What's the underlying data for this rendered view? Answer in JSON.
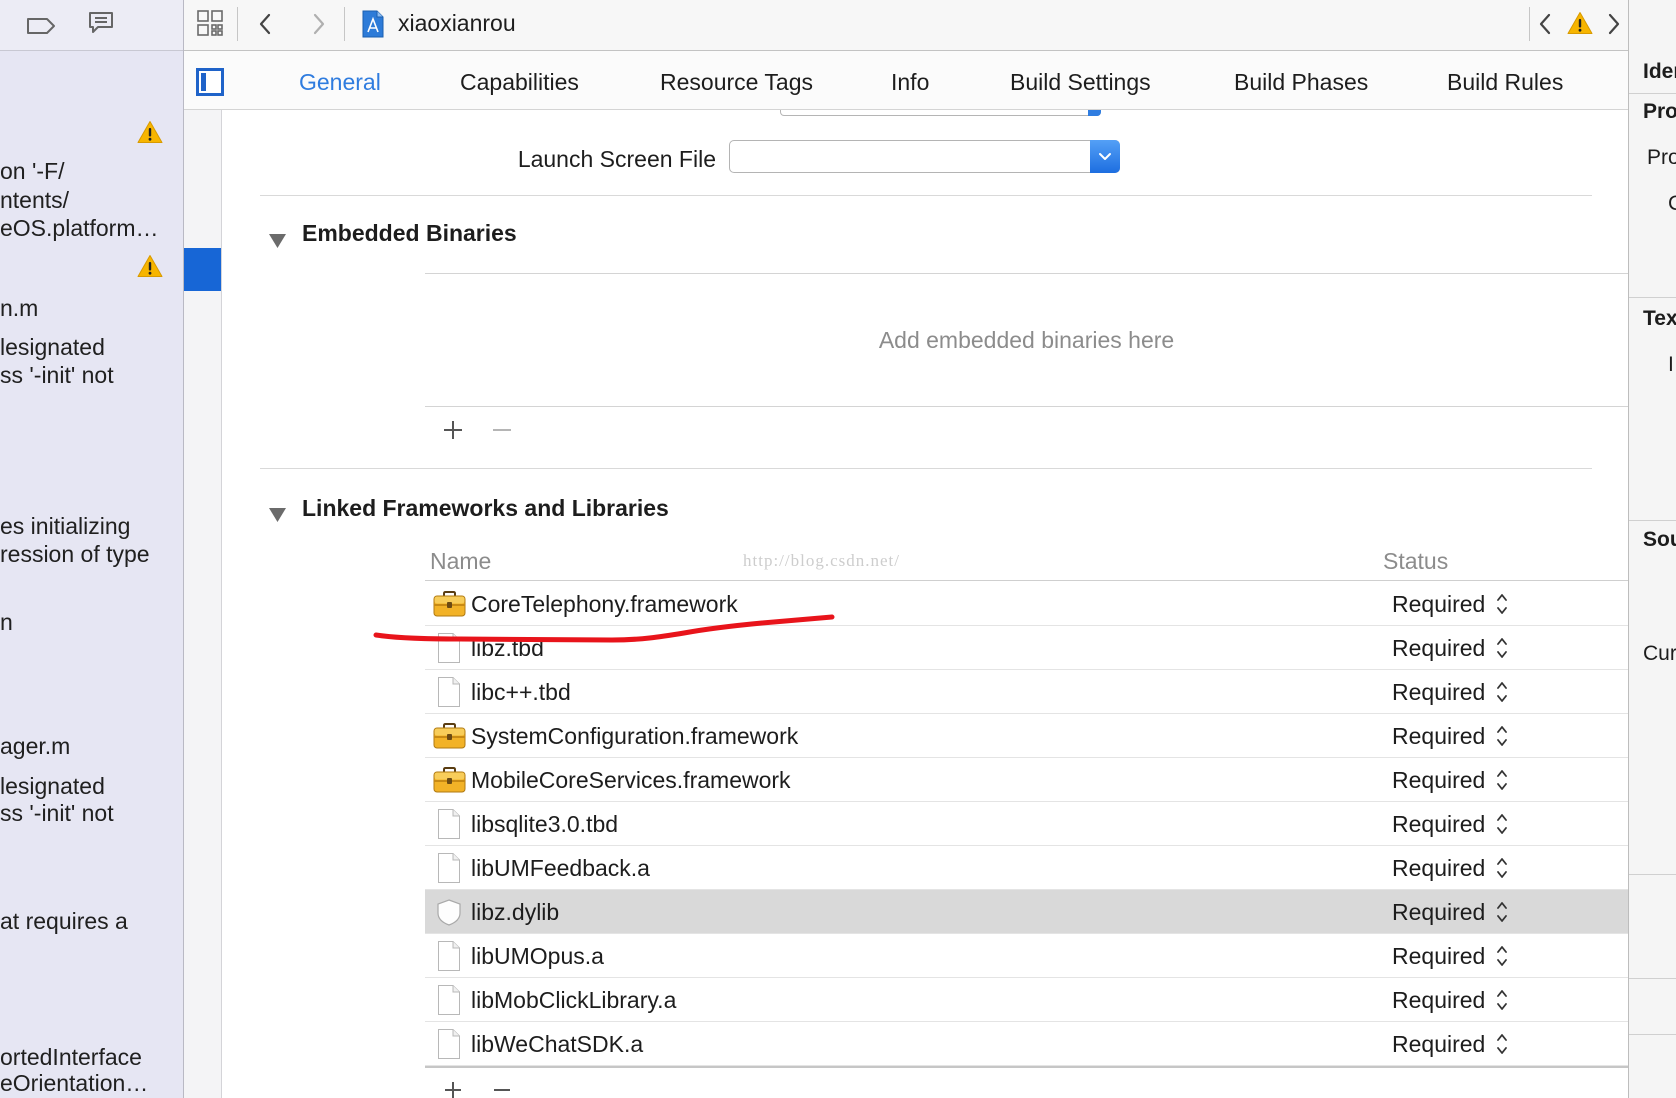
{
  "navigator": {
    "lines": [
      "on '-F/",
      "ntents/",
      "eOS.platform…",
      "n.m",
      "lesignated",
      "ss '-init' not",
      "es initializing",
      "ression of type",
      "n",
      "ager.m",
      "lesignated",
      "ss '-init' not",
      "at requires a",
      "ortedInterface",
      "eOrientation…"
    ]
  },
  "jump_bar": {
    "project_name": "xiaoxianrou"
  },
  "tabs": [
    {
      "label": "General",
      "active": true
    },
    {
      "label": "Capabilities",
      "active": false
    },
    {
      "label": "Resource Tags",
      "active": false
    },
    {
      "label": "Info",
      "active": false
    },
    {
      "label": "Build Settings",
      "active": false
    },
    {
      "label": "Build Phases",
      "active": false
    },
    {
      "label": "Build Rules",
      "active": false
    }
  ],
  "general": {
    "launch_screen": {
      "label": "Launch Screen File"
    },
    "embedded_binaries": {
      "title": "Embedded Binaries",
      "placeholder": "Add embedded binaries here"
    },
    "linked_frameworks": {
      "title": "Linked Frameworks and Libraries",
      "columns": {
        "name": "Name",
        "status": "Status"
      },
      "watermark": "http://blog.csdn.net/",
      "rows": [
        {
          "name": "CoreTelephony.framework",
          "status": "Required",
          "icon": "framework-icon",
          "selected": false
        },
        {
          "name": "libz.tbd",
          "status": "Required",
          "icon": "file-icon",
          "selected": false
        },
        {
          "name": "libc++.tbd",
          "status": "Required",
          "icon": "file-icon",
          "selected": false
        },
        {
          "name": "SystemConfiguration.framework",
          "status": "Required",
          "icon": "framework-icon",
          "selected": false
        },
        {
          "name": "MobileCoreServices.framework",
          "status": "Required",
          "icon": "framework-icon",
          "selected": false
        },
        {
          "name": "libsqlite3.0.tbd",
          "status": "Required",
          "icon": "file-icon",
          "selected": false
        },
        {
          "name": "libUMFeedback.a",
          "status": "Required",
          "icon": "file-icon",
          "selected": false
        },
        {
          "name": "libz.dylib",
          "status": "Required",
          "icon": "dylib-icon",
          "selected": true
        },
        {
          "name": "libUMOpus.a",
          "status": "Required",
          "icon": "file-icon",
          "selected": false
        },
        {
          "name": "libMobClickLibrary.a",
          "status": "Required",
          "icon": "file-icon",
          "selected": false
        },
        {
          "name": "libWeChatSDK.a",
          "status": "Required",
          "icon": "file-icon",
          "selected": false
        }
      ]
    }
  },
  "inspector": {
    "labels": [
      "Iden",
      "Proj",
      "Pro",
      "C",
      "Text",
      "I",
      "Sou",
      "Cur"
    ]
  },
  "colors": {
    "accent": "#2f7cdf",
    "selection": "#1766d6",
    "warning": "#f7b500",
    "annotation": "#e8141b",
    "row_highlight": "#d9d9d9"
  }
}
